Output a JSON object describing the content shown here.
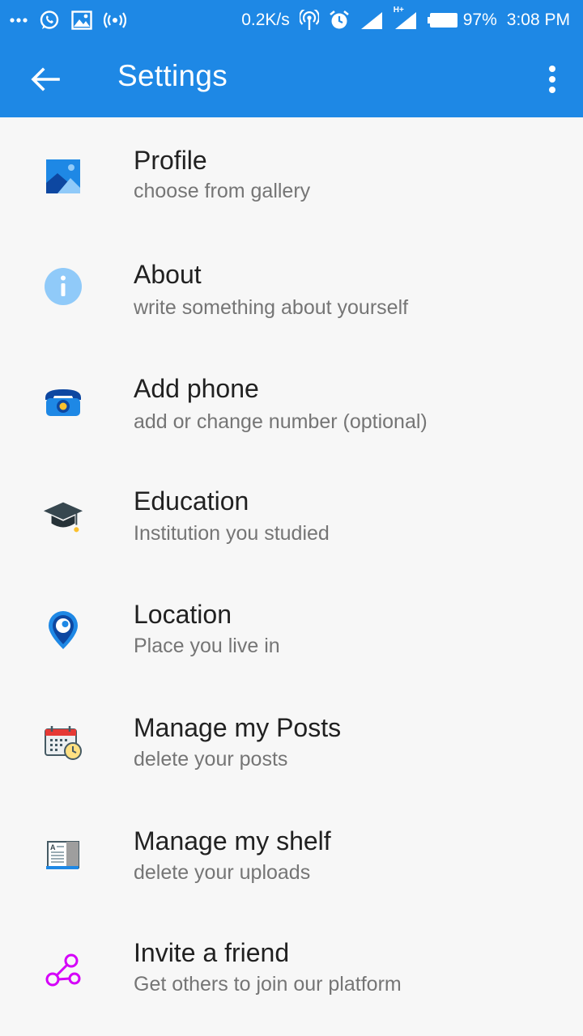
{
  "status_bar": {
    "net_speed": "0.2K/s",
    "network_type": "H+",
    "battery": "97%",
    "time": "3:08 PM",
    "icons": [
      "more-dots-icon",
      "whatsapp-icon",
      "image-icon",
      "radio-broadcast-icon",
      "hotspot-icon",
      "alarm-icon",
      "signal-icon",
      "signal-hplus-icon",
      "battery-icon"
    ]
  },
  "app_bar": {
    "title": "Settings",
    "back_icon": "arrow-back-icon",
    "menu_icon": "more-vert-icon",
    "color": "#1e88e5"
  },
  "settings": [
    {
      "title": "Profile",
      "subtitle": "choose from gallery",
      "icon": "gallery-image-icon"
    },
    {
      "title": "About",
      "subtitle": "write something about yourself",
      "icon": "info-icon"
    },
    {
      "title": "Add phone",
      "subtitle": "add or change number (optional)",
      "icon": "telephone-icon"
    },
    {
      "title": "Education",
      "subtitle": "Institution you studied",
      "icon": "graduation-cap-icon"
    },
    {
      "title": "Location",
      "subtitle": "Place you live in",
      "icon": "location-pin-icon"
    },
    {
      "title": "Manage my Posts",
      "subtitle": "delete your posts",
      "icon": "calendar-clock-icon"
    },
    {
      "title": "Manage my shelf",
      "subtitle": "delete your uploads",
      "icon": "book-icon"
    },
    {
      "title": "Invite a friend",
      "subtitle": "Get others to join our platform",
      "icon": "share-network-icon"
    }
  ]
}
